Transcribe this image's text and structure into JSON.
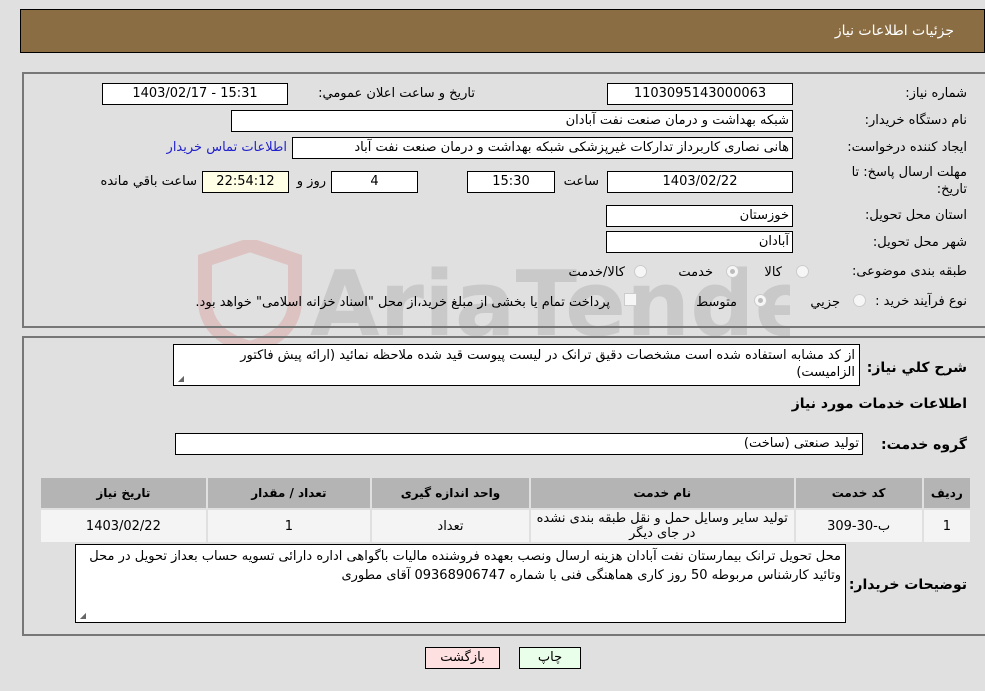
{
  "header": {
    "title": "جزئيات اطلاعات نياز"
  },
  "form": {
    "need_number": {
      "label": "شماره نياز:",
      "value": "1103095143000063"
    },
    "announce_datetime": {
      "label": "تاريخ و ساعت اعلان عمومي:",
      "value": "1403/02/17 - 15:31"
    },
    "buyer_org": {
      "label": "نام دستگاه خريدار:",
      "value": "شبکه بهداشت و درمان صنعت نفت آبادان"
    },
    "requester": {
      "label": "ايجاد کننده درخواست:",
      "value": "هانی نصاری کاربرداز تدارکات غیرپزشکی شبکه بهداشت و درمان صنعت نفت آباد",
      "contact_link": "اطلاعات تماس خريدار"
    },
    "deadline": {
      "label_line1": "مهلت ارسال پاسخ: تا",
      "label_line2": "تاريخ:",
      "date": "1403/02/22",
      "time_label": "ساعت",
      "time": "15:30",
      "days": "4",
      "days_label": "روز و",
      "remaining": "22:54:12",
      "remaining_label": "ساعت باقي مانده"
    },
    "province": {
      "label": "استان محل تحويل:",
      "value": "خوزستان"
    },
    "city": {
      "label": "شهر محل تحويل:",
      "value": "آبادان"
    },
    "category": {
      "label": "طبقه بندی موضوعی:",
      "options": [
        "کالا",
        "خدمت",
        "کالا/خدمت"
      ],
      "selected": "خدمت"
    },
    "purchase_type": {
      "label": "نوع فرآيند خريد :",
      "options": [
        "جزيي",
        "متوسط"
      ],
      "selected": "متوسط",
      "treasury_checkbox_label": "پرداخت تمام یا بخشی از مبلغ خرید،از محل \"اسناد خزانه اسلامی\" خواهد بود."
    }
  },
  "description": {
    "label": "شرح کلي نياز:",
    "value": "از کد مشابه استفاده شده است مشخصات دقیق ترانک در لیست پیوست قید شده ملاحظه نمائید (ارائه پیش فاکتور الزامیست)"
  },
  "services_section": {
    "title": "اطلاعات خدمات مورد نياز",
    "group_label": "گروه خدمت:",
    "group_value": "تولید صنعتی (ساخت)"
  },
  "table": {
    "headers": [
      "رديف",
      "کد خدمت",
      "نام خدمت",
      "واحد اندازه گيری",
      "تعداد / مقدار",
      "تاريخ نياز"
    ],
    "rows": [
      [
        "1",
        "ب-30-309",
        "تولید سایر وسایل حمل و نقل طبقه بندی نشده در جای دیگر",
        "تعداد",
        "1",
        "1403/02/22"
      ]
    ]
  },
  "buyer_notes": {
    "label": "توضيحات خريدار:",
    "value": "محل تحویل ترانک بیمارستان نفت آبادان هزینه ارسال ونصب بعهده فروشنده مالیات باگواهی اداره دارائی تسویه حساب بعداز تحویل در محل وتائید کارشناس مربوطه 50 روز کاری هماهنگی فنی با شماره 09368906747 آقای مطوری"
  },
  "buttons": {
    "print": "چاپ",
    "back": "بازگشت"
  },
  "watermark": "AriaTender.neT",
  "colors": {
    "header_bg": "#8b6d44",
    "print_bg": "#eaffea",
    "back_bg": "#ffe0e0",
    "link": "#2222cc"
  }
}
